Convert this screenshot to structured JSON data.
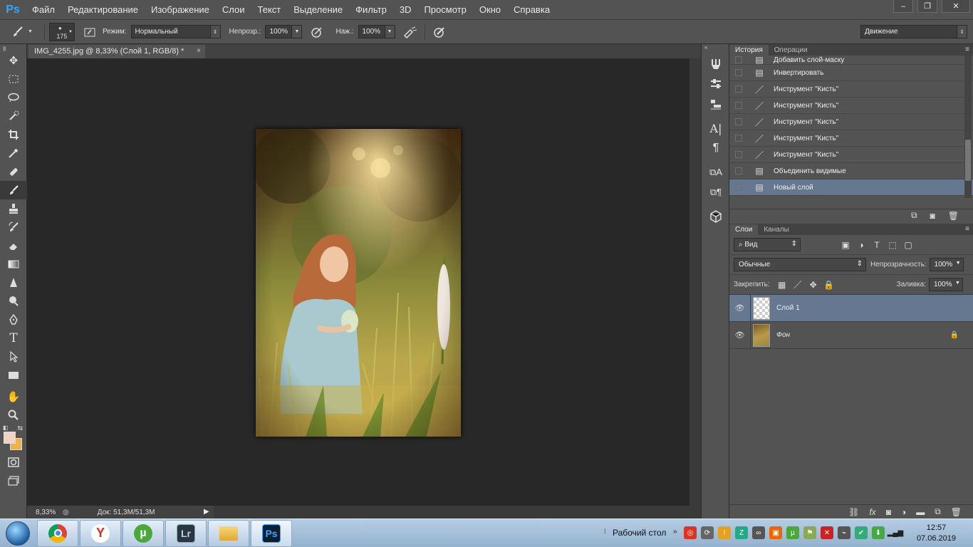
{
  "app": {
    "logo": "Ps"
  },
  "menu": [
    "Файл",
    "Редактирование",
    "Изображение",
    "Слои",
    "Текст",
    "Выделение",
    "Фильтр",
    "3D",
    "Просмотр",
    "Окно",
    "Справка"
  ],
  "window_controls": {
    "minimize": "–",
    "restore": "❐",
    "close": "✕"
  },
  "options": {
    "brush_size": "175",
    "mode_label": "Режим:",
    "mode_value": "Нормальный",
    "opacity_label": "Непрозр.:",
    "opacity_value": "100%",
    "flow_label": "Наж.:",
    "flow_value": "100%",
    "workspace": "Движение"
  },
  "document": {
    "tab_title": "IMG_4255.jpg @ 8,33% (Слой 1, RGB/8) *",
    "close": "×",
    "zoom": "8,33%",
    "doc_size": "Док: 51,3M/51,3M"
  },
  "tools": [
    "move-tool",
    "marquee-tool",
    "lasso-tool",
    "quick-selection-tool",
    "crop-tool",
    "eyedropper-tool",
    "healing-brush-tool",
    "brush-tool",
    "clone-stamp-tool",
    "history-brush-tool",
    "eraser-tool",
    "gradient-tool",
    "blur-tool",
    "dodge-tool",
    "pen-tool",
    "type-tool",
    "path-selection-tool",
    "rectangle-tool",
    "hand-tool",
    "zoom-tool"
  ],
  "colors": {
    "foreground": "#f2d2c2",
    "background": "#f0b24a",
    "selection": "#65788f",
    "accent": "#31a8ff"
  },
  "history": {
    "tabs": [
      "История",
      "Операции"
    ],
    "items": [
      {
        "label": "Добавить слой-маску",
        "icon": "document-icon"
      },
      {
        "label": "Инвертировать",
        "icon": "document-icon"
      },
      {
        "label": "Инструмент \"Кисть\"",
        "icon": "brush-icon"
      },
      {
        "label": "Инструмент \"Кисть\"",
        "icon": "brush-icon"
      },
      {
        "label": "Инструмент \"Кисть\"",
        "icon": "brush-icon"
      },
      {
        "label": "Инструмент \"Кисть\"",
        "icon": "brush-icon"
      },
      {
        "label": "Инструмент \"Кисть\"",
        "icon": "brush-icon"
      },
      {
        "label": "Объединить видимые",
        "icon": "document-icon"
      },
      {
        "label": "Новый слой",
        "icon": "document-icon"
      }
    ]
  },
  "layers": {
    "tabs": [
      "Слои",
      "Каналы"
    ],
    "filter_label": "Вид",
    "blend_mode": "Обычные",
    "opacity_label": "Непрозрачность:",
    "opacity_value": "100%",
    "lock_label": "Закрепить:",
    "fill_label": "Заливка:",
    "fill_value": "100%",
    "items": [
      {
        "name": "Слой 1",
        "selected": true
      },
      {
        "name": "Фон",
        "selected": false,
        "locked": true
      }
    ]
  },
  "taskbar": {
    "apps": [
      "chrome",
      "yandex-browser",
      "utorrent",
      "lightroom",
      "explorer",
      "photoshop"
    ],
    "lightroom_label": "Lr",
    "photoshop_label": "Ps",
    "yandex_label": "Y",
    "desktop_label": "Рабочий стол",
    "time": "12:57",
    "date": "07.06.2019"
  }
}
